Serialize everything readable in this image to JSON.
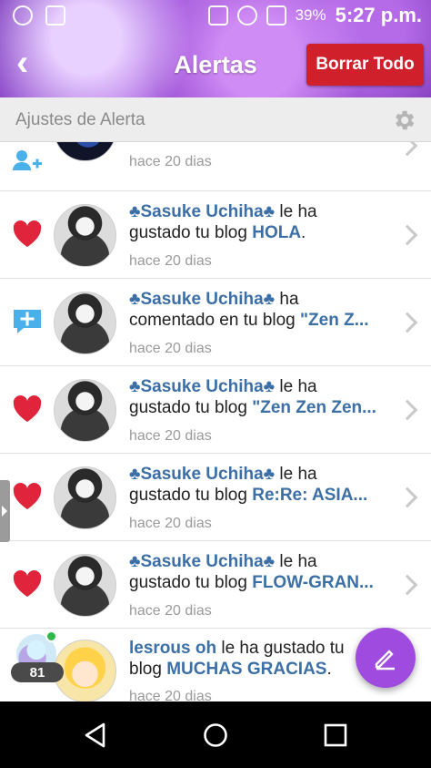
{
  "status_bar": {
    "battery": "39%",
    "time": "5:27 p.m."
  },
  "header": {
    "title": "Alertas",
    "clear_all_label": "Borrar Todo"
  },
  "settings": {
    "label": "Ajustes de Alerta"
  },
  "notifications": [
    {
      "icon": "add-user-icon",
      "avatar": "dark",
      "time": "hace 20 dias"
    },
    {
      "icon": "heart-icon",
      "user": "♣Sasuke Uchiha♣",
      "line1_rest": " le ha",
      "line2_prefix": "gustado tu blog ",
      "object": "HOLA",
      "line2_suffix": ".",
      "time": "hace 20 dias"
    },
    {
      "icon": "comment-icon",
      "user": "♣Sasuke Uchiha♣",
      "line1_rest": " ha",
      "line2_prefix": "comentado en tu blog ",
      "object": "\"Zen Z...",
      "line2_suffix": "",
      "time": "hace 20 dias"
    },
    {
      "icon": "heart-icon",
      "user": "♣Sasuke Uchiha♣",
      "line1_rest": " le ha",
      "line2_prefix": "gustado tu blog ",
      "object": "\"Zen Zen Zen...",
      "line2_suffix": "",
      "time": "hace 20 dias"
    },
    {
      "icon": "heart-icon",
      "user": "♣Sasuke Uchiha♣",
      "line1_rest": " le ha",
      "line2_prefix": "gustado tu blog ",
      "object": "Re:Re: ASIA...",
      "line2_suffix": "",
      "time": "hace 20 dias"
    },
    {
      "icon": "heart-icon",
      "user": "♣Sasuke Uchiha♣",
      "line1_rest": " le ha",
      "line2_prefix": "gustado tu blog ",
      "object": "FLOW-GRAN...",
      "line2_suffix": "",
      "time": "hace 20 dias"
    },
    {
      "icon": "none",
      "user": "lesrous oh",
      "line1_rest": " le ha gustado tu",
      "line2_prefix": "blog ",
      "object": "MUCHAS GRACIAS",
      "line2_suffix": ".",
      "time": "hace 20 dias",
      "level_badge": "81"
    }
  ],
  "colors": {
    "accent_purple": "#a04be0",
    "clear_button_red": "#d0202c",
    "heart_red": "#e0243b",
    "comment_blue": "#4ab0ea",
    "link_blue": "#3b6fa6"
  }
}
